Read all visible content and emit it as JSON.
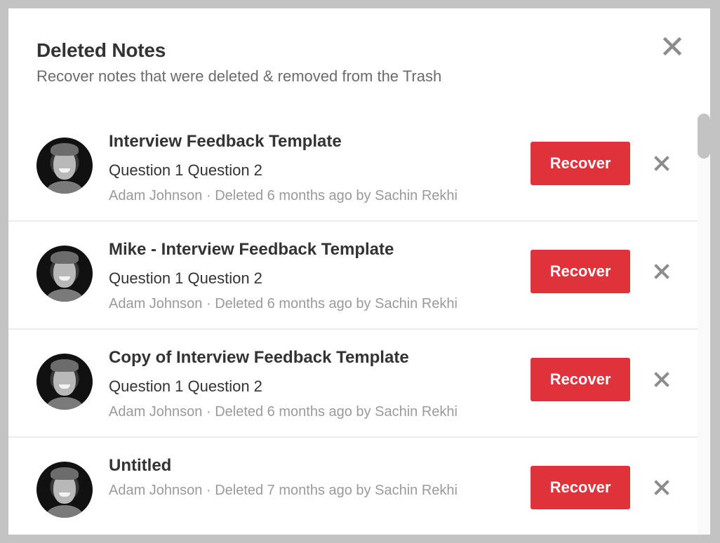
{
  "dialog": {
    "title": "Deleted Notes",
    "subtitle": "Recover notes that were deleted & removed from the Trash",
    "close_icon": "close-icon"
  },
  "colors": {
    "accent": "#e0323a",
    "title_text": "#333333",
    "meta_text": "#9a9a9a",
    "icon": "#8c8c8c",
    "backdrop": "#c3c3c3"
  },
  "notes": [
    {
      "title": "Interview Feedback Template",
      "preview": "Question 1 Question 2",
      "meta": "Adam Johnson · Deleted 6 months ago by Sachin Rekhi",
      "recover_label": "Recover",
      "remove_icon": "close-icon"
    },
    {
      "title": "Mike - Interview Feedback Template",
      "preview": "Question 1 Question 2",
      "meta": "Adam Johnson · Deleted 6 months ago by Sachin Rekhi",
      "recover_label": "Recover",
      "remove_icon": "close-icon"
    },
    {
      "title": "Copy of Interview Feedback Template",
      "preview": "Question 1 Question 2",
      "meta": "Adam Johnson · Deleted 6 months ago by Sachin Rekhi",
      "recover_label": "Recover",
      "remove_icon": "close-icon"
    },
    {
      "title": "Untitled",
      "preview": "",
      "meta": "Adam Johnson · Deleted 7 months ago by Sachin Rekhi",
      "recover_label": "Recover",
      "remove_icon": "close-icon"
    }
  ]
}
